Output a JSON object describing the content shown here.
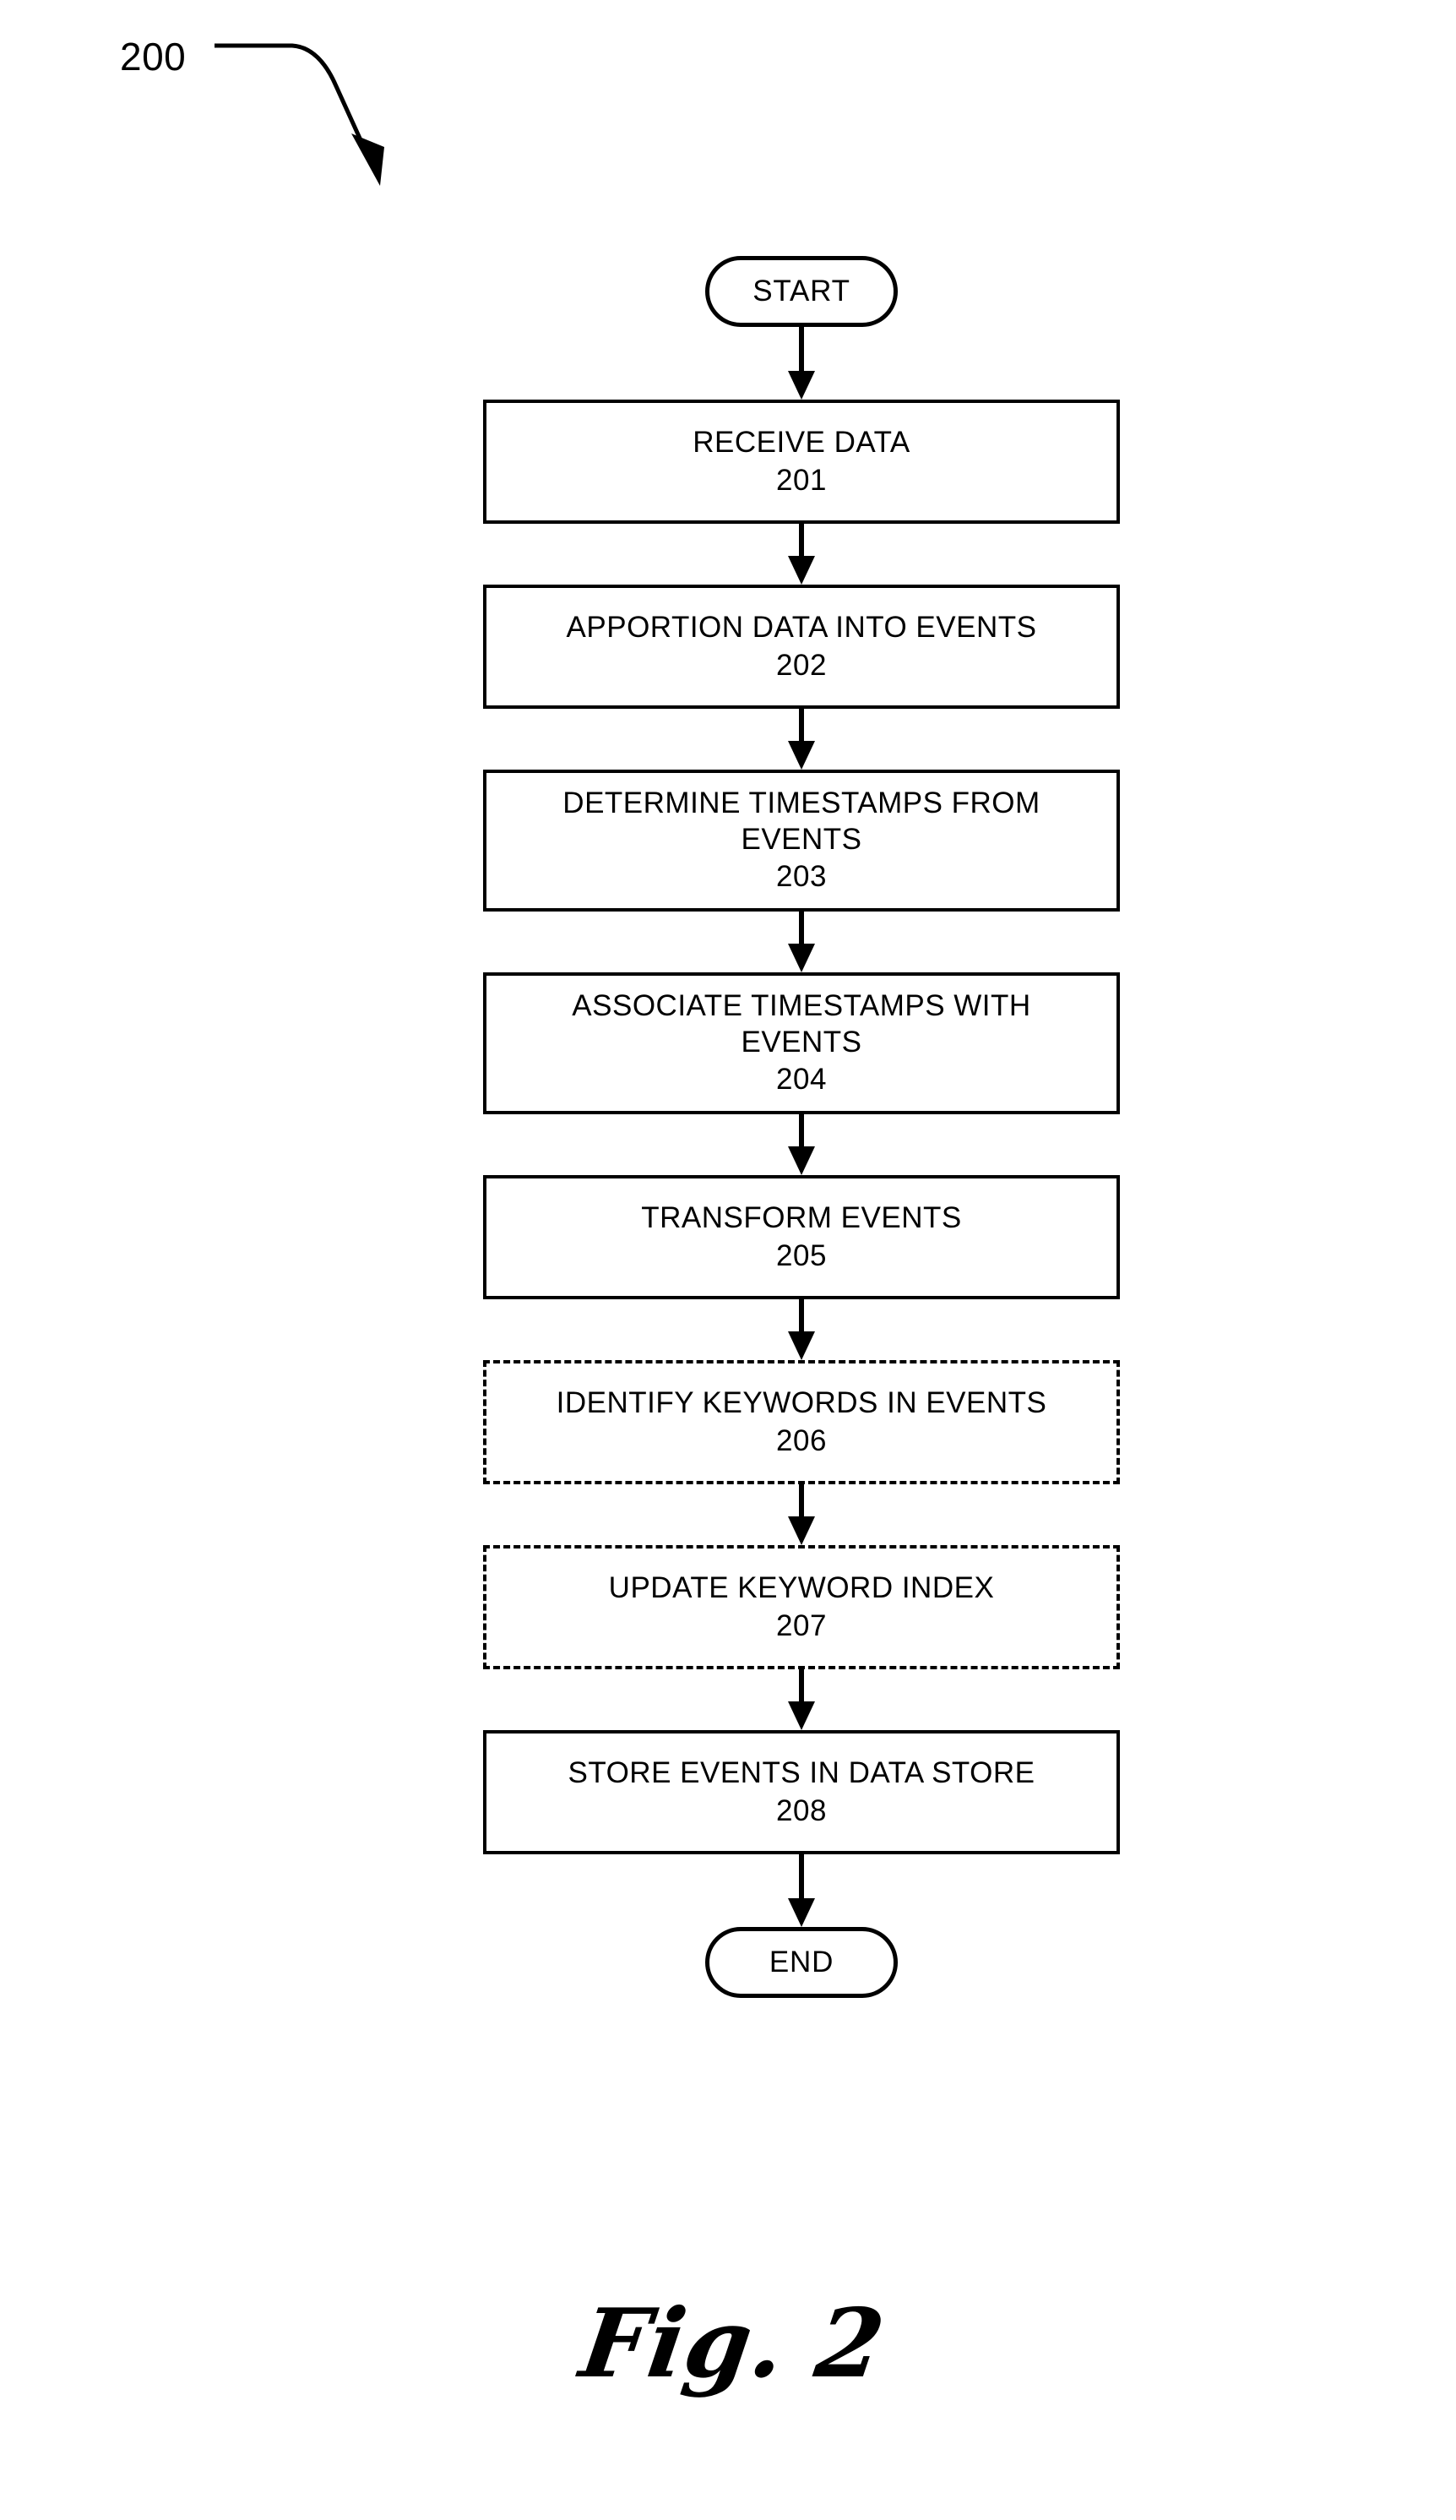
{
  "figure": {
    "reference_numeral": "200",
    "caption": "Fig. 2"
  },
  "flowchart": {
    "nodes": [
      {
        "id": "start",
        "shape": "terminator",
        "label": "START",
        "style": "solid"
      },
      {
        "id": "step-201",
        "shape": "process",
        "label": "RECEIVE DATA",
        "number": "201",
        "style": "solid"
      },
      {
        "id": "step-202",
        "shape": "process",
        "label": "APPORTION DATA INTO EVENTS",
        "number": "202",
        "style": "solid"
      },
      {
        "id": "step-203",
        "shape": "process",
        "label": "DETERMINE TIMESTAMPS FROM\nEVENTS",
        "number": "203",
        "style": "solid"
      },
      {
        "id": "step-204",
        "shape": "process",
        "label": "ASSOCIATE TIMESTAMPS WITH\nEVENTS",
        "number": "204",
        "style": "solid"
      },
      {
        "id": "step-205",
        "shape": "process",
        "label": "TRANSFORM EVENTS",
        "number": "205",
        "style": "solid"
      },
      {
        "id": "step-206",
        "shape": "process",
        "label": "IDENTIFY KEYWORDS IN EVENTS",
        "number": "206",
        "style": "dashed"
      },
      {
        "id": "step-207",
        "shape": "process",
        "label": "UPDATE KEYWORD INDEX",
        "number": "207",
        "style": "dashed"
      },
      {
        "id": "step-208",
        "shape": "process",
        "label": "STORE EVENTS IN DATA STORE",
        "number": "208",
        "style": "solid"
      },
      {
        "id": "end",
        "shape": "terminator",
        "label": "END",
        "style": "solid"
      }
    ],
    "edges": [
      {
        "from": "start",
        "to": "step-201",
        "arrow": "down"
      },
      {
        "from": "step-201",
        "to": "step-202",
        "arrow": "down"
      },
      {
        "from": "step-202",
        "to": "step-203",
        "arrow": "down"
      },
      {
        "from": "step-203",
        "to": "step-204",
        "arrow": "down"
      },
      {
        "from": "step-204",
        "to": "step-205",
        "arrow": "down"
      },
      {
        "from": "step-205",
        "to": "step-206",
        "arrow": "down"
      },
      {
        "from": "step-206",
        "to": "step-207",
        "arrow": "down"
      },
      {
        "from": "step-207",
        "to": "step-208",
        "arrow": "down"
      },
      {
        "from": "step-208",
        "to": "end",
        "arrow": "down"
      }
    ]
  },
  "colors": {
    "ink": "#000000",
    "paper": "#ffffff"
  }
}
